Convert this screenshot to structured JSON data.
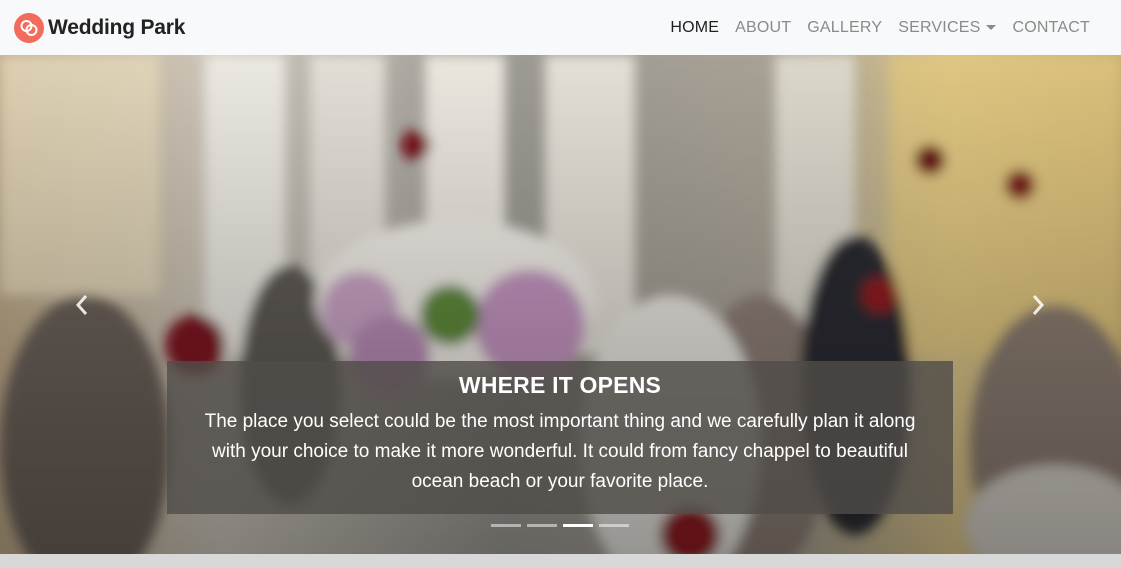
{
  "navbar": {
    "brand": "Wedding Park",
    "logo_icon": "interlocking-rings-icon",
    "accent_color": "#f26b5b",
    "items": [
      {
        "label": "HOME",
        "active": true
      },
      {
        "label": "ABOUT",
        "active": false
      },
      {
        "label": "GALLERY",
        "active": false
      },
      {
        "label": "SERVICES",
        "active": false,
        "dropdown": true
      },
      {
        "label": "CONTACT",
        "active": false
      }
    ]
  },
  "carousel": {
    "caption_title": "WHERE IT OPENS",
    "caption_text": "The place you select could be the most important thing and we carefully plan it along with your choice to make it more wonderful. It could from fancy chappel to beautiful ocean beach or your favorite place.",
    "prev_icon": "chevron-left-icon",
    "next_icon": "chevron-right-icon",
    "indicator_count": 4,
    "active_indicator": 3
  }
}
